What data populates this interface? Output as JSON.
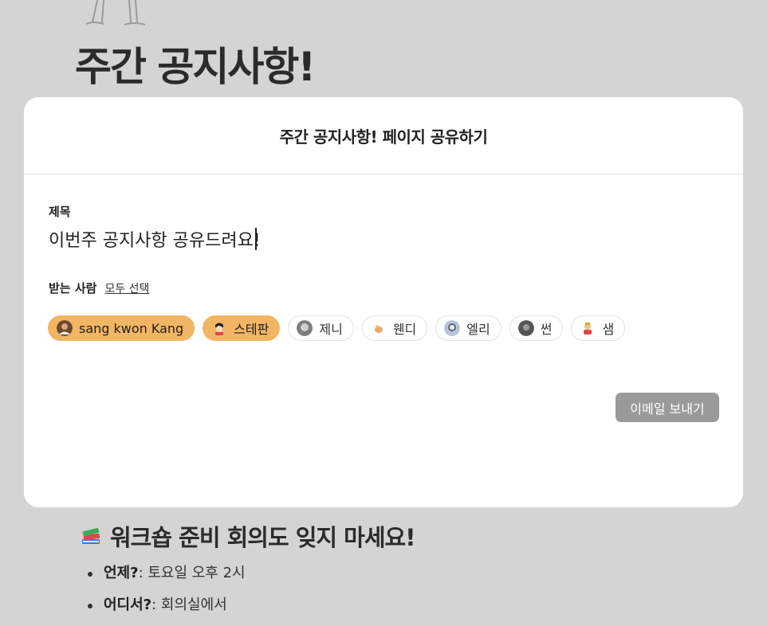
{
  "background": {
    "page_title": "주간 공지사항!",
    "section": {
      "emoji": "books-icon",
      "title": "워크숍 준비 회의도 잊지 마세요!"
    },
    "bullets": [
      {
        "label": "언제?",
        "value": ": 토요일 오후 2시"
      },
      {
        "label": "어디서?",
        "value": ": 회의실에서"
      }
    ]
  },
  "modal": {
    "title": "주간 공지사항! 페이지 공유하기",
    "subject_label": "제목",
    "subject_value": "이번주 공지사항 공유드려요!",
    "recipients_label": "받는 사람",
    "select_all": "모두 선택",
    "recipients": [
      {
        "name": "sang kwon Kang",
        "selected": true,
        "avatar": "person-avatar"
      },
      {
        "name": "스테판",
        "selected": true,
        "avatar": "cartoon-avatar"
      },
      {
        "name": "제니",
        "selected": false,
        "avatar": "person-avatar"
      },
      {
        "name": "웬디",
        "selected": false,
        "avatar": "animal-avatar"
      },
      {
        "name": "엘리",
        "selected": false,
        "avatar": "person-avatar"
      },
      {
        "name": "썬",
        "selected": false,
        "avatar": "person-avatar"
      },
      {
        "name": "샘",
        "selected": false,
        "avatar": "cartoon-avatar"
      }
    ],
    "send_button": "이메일 보내기"
  },
  "colors": {
    "overlay": "#d4d4d4",
    "selected_chip": "#f2b563",
    "send_button": "#9a9a9a"
  }
}
